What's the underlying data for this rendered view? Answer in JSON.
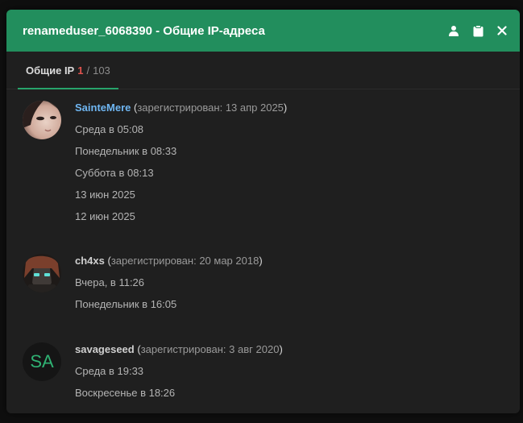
{
  "modal": {
    "title": "renameduser_6068390 - Общие IP-адреса"
  },
  "header_icons": {
    "user": "user-icon",
    "clipboard": "clipboard-icon",
    "close": "close-icon"
  },
  "tab": {
    "label": "Общие IP",
    "count": "1",
    "separator": "/",
    "total": "103"
  },
  "users": [
    {
      "name": "SainteMere",
      "registered_label": "зарегистрирован:",
      "registered_date": "13 апр 2025",
      "times": [
        "Среда в 05:08",
        "Понедельник в 08:33",
        "Суббота в 08:13",
        "13 июн 2025",
        "12 июн 2025"
      ]
    },
    {
      "name": "ch4xs",
      "registered_label": "зарегистрирован:",
      "registered_date": "20 мар 2018",
      "times": [
        "Вчера, в 11:26",
        "Понедельник в 16:05"
      ]
    },
    {
      "name": "savageseed",
      "avatar_initials": "SA",
      "registered_label": "зарегистрирован:",
      "registered_date": "3 авг 2020",
      "times": [
        "Среда в 19:33",
        "Воскресенье в 18:26"
      ]
    }
  ],
  "colors": {
    "header": "#228e5d",
    "accent": "#27a46b",
    "count": "#e0534e",
    "link_blue": "#6fb6f2"
  }
}
